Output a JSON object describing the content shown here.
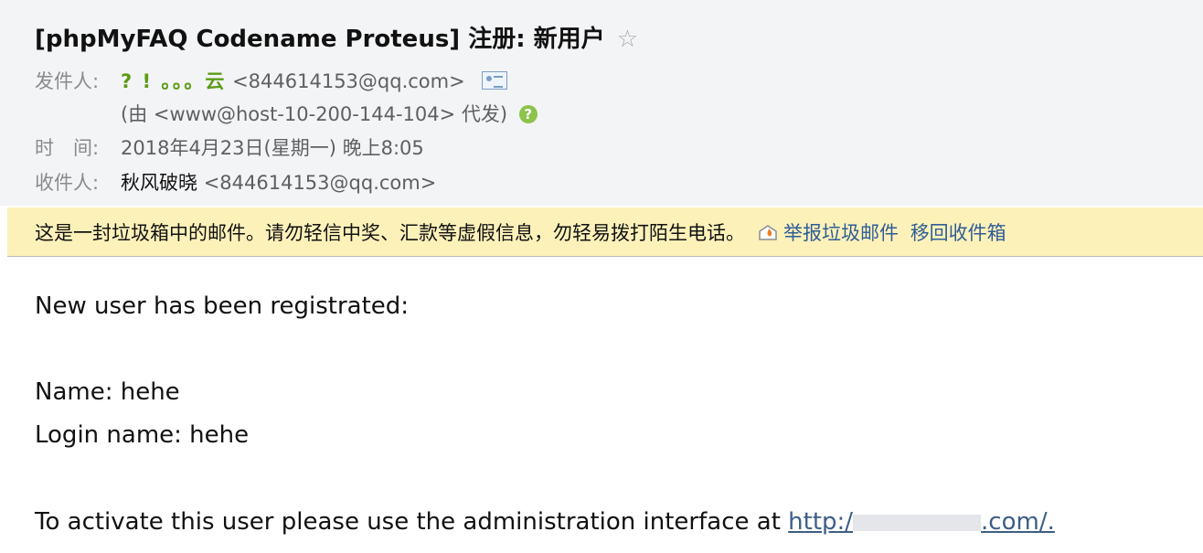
{
  "email": {
    "subject": "[phpMyFAQ Codename Proteus] 注册: 新用户",
    "star_glyph": "☆",
    "from_label": "发件人:",
    "sender_name": "? ! 。。。云",
    "sender_address": "<844614153@qq.com>",
    "sent_on_behalf": "(由 <www@host-10-200-144-104> 代发)",
    "time_label": "时　间:",
    "time_value": "2018年4月23日(星期一) 晚上8:05",
    "to_label": "收件人:",
    "to_name": "秋风破晓",
    "to_address": "<844614153@qq.com>"
  },
  "warning": {
    "text": "这是一封垃圾箱中的邮件。请勿轻信中奖、汇款等虚假信息，勿轻易拨打陌生电话。",
    "report_link": "举报垃圾邮件",
    "move_link": "移回收件箱"
  },
  "body": {
    "line1": "New user has been registrated:",
    "name_line": "Name: hehe",
    "login_line": "Login name: hehe",
    "activate_prefix": "To activate this user please use the administration interface at ",
    "url_start": "http:/",
    "url_end": ".com/."
  },
  "colors": {
    "sender_green": "#5c9b16",
    "warning_bg": "#fdf1ba",
    "link_blue": "#2f5d96"
  },
  "icons": [
    "star-icon",
    "vcard-icon",
    "help-icon",
    "flame-icon"
  ]
}
